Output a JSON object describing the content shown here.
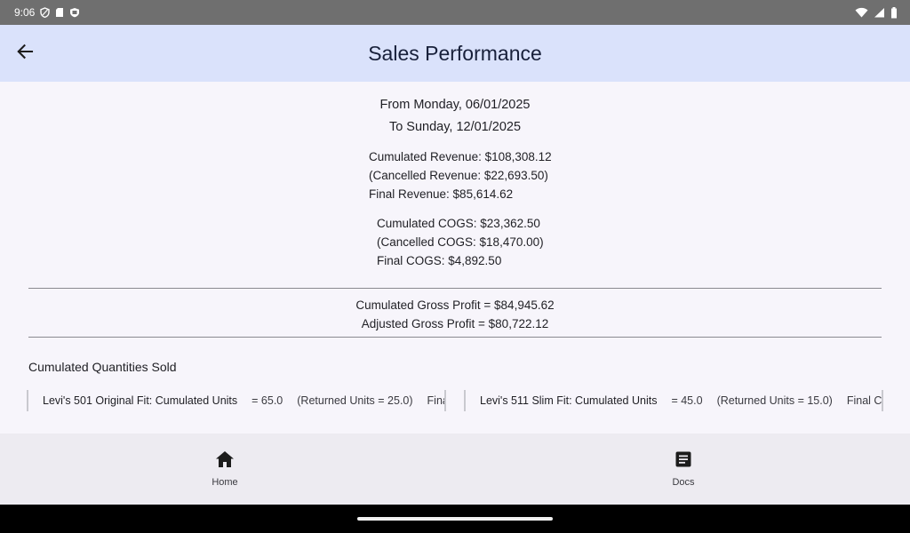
{
  "status_bar": {
    "time": "9:06",
    "left_icons": [
      "shield-icon",
      "sim-card-icon",
      "security-badge-icon"
    ],
    "right_icons": [
      "wifi-icon",
      "signal-icon",
      "battery-icon"
    ]
  },
  "app_bar": {
    "title": "Sales Performance",
    "back_icon": "arrow-back-icon"
  },
  "report": {
    "from_date": "From Monday, 06/01/2025",
    "to_date": "To Sunday, 12/01/2025",
    "revenue": {
      "cumulated": "Cumulated Revenue: $108,308.12",
      "cancelled": "(Cancelled Revenue: $22,693.50)",
      "final": "Final Revenue: $85,614.62"
    },
    "cogs": {
      "cumulated": "Cumulated COGS: $23,362.50",
      "cancelled": "(Cancelled COGS: $18,470.00)",
      "final": "Final COGS: $4,892.50"
    },
    "profit": {
      "cumulated": "Cumulated Gross Profit = $84,945.62",
      "adjusted": "Adjusted Gross Profit = $80,722.12"
    },
    "quantities_title": "Cumulated Quantities Sold",
    "products": [
      {
        "name": "Levi's 501 Original Fit: Cumulated Units",
        "units": "= 65.0",
        "returned": "(Returned Units = 25.0)",
        "final": "Fina"
      },
      {
        "name": "Levi's 511 Slim Fit: Cumulated Units",
        "units": "= 45.0",
        "returned": "(Returned Units = 15.0)",
        "final": "Final Cu"
      }
    ]
  },
  "bottom_nav": {
    "items": [
      {
        "label": "Home",
        "icon": "home-icon"
      },
      {
        "label": "Docs",
        "icon": "docs-icon"
      }
    ]
  }
}
